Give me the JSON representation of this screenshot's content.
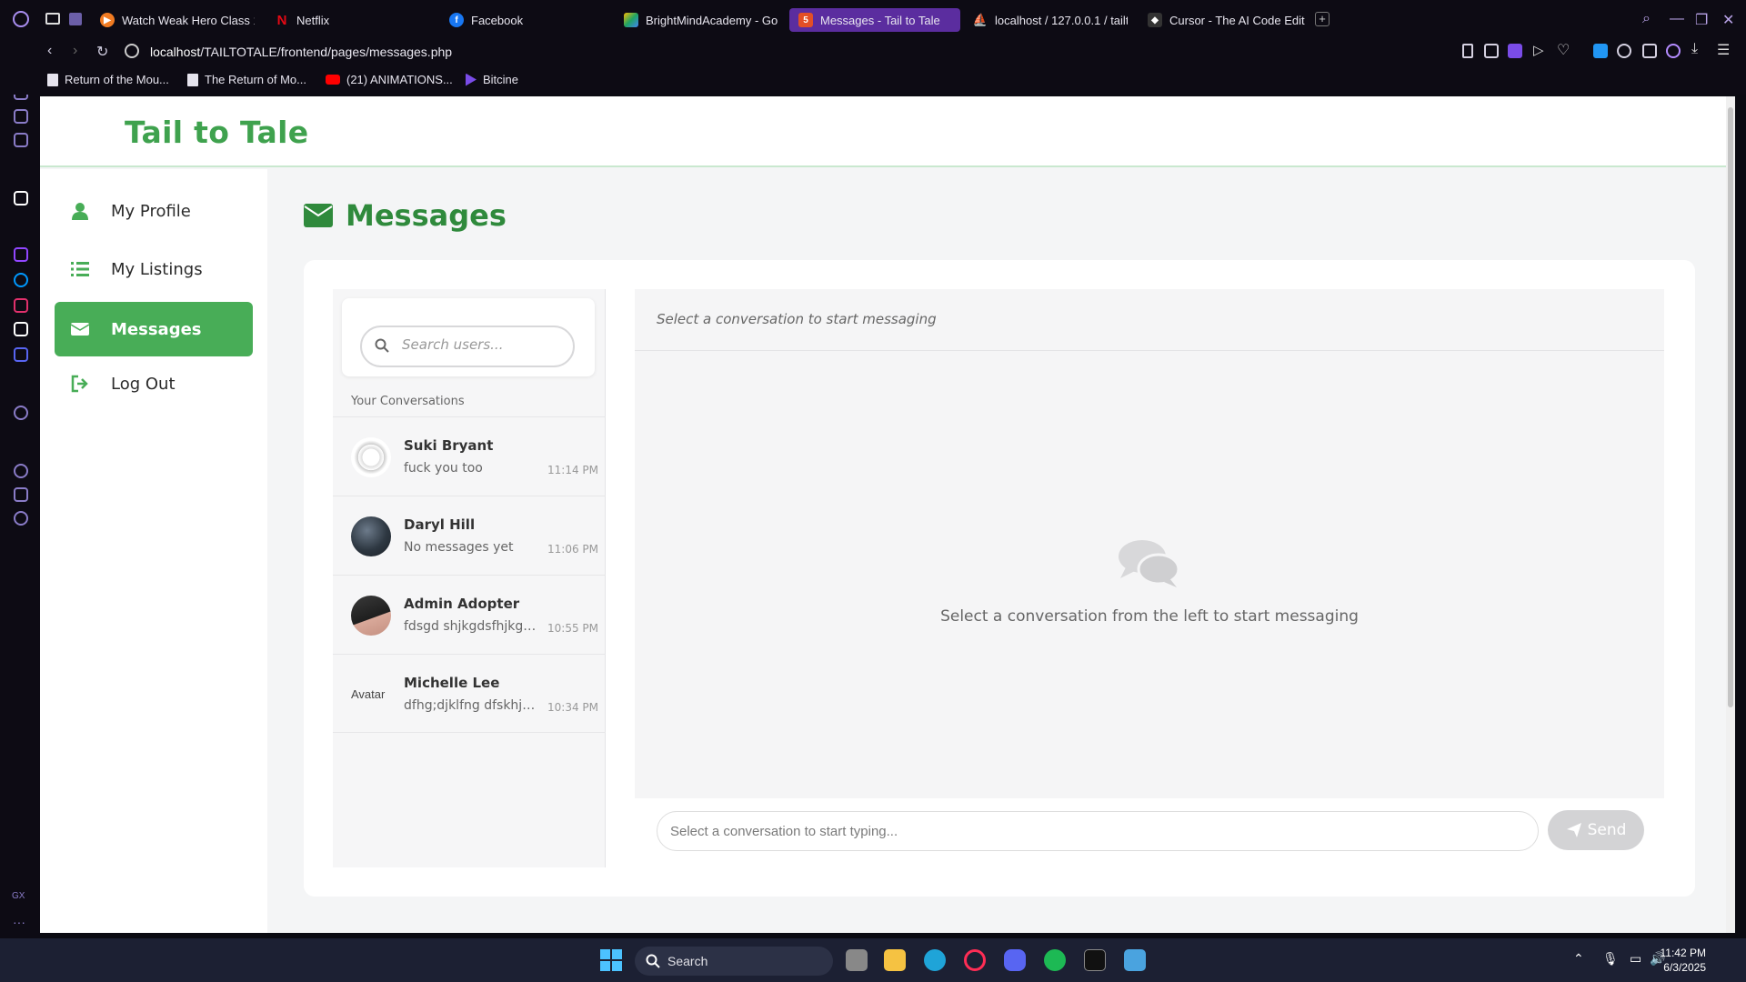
{
  "browser": {
    "tabs": [
      {
        "label": "Watch Weak Hero Class 1",
        "color": "#f07b22"
      },
      {
        "label": "Netflix",
        "color": "#e50914"
      },
      {
        "label": "Facebook",
        "color": "#1877f2"
      },
      {
        "label": "BrightMindAcademy - Go",
        "color": "#1fa463"
      },
      {
        "label": "Messages - Tail to Tale",
        "color": "#e34f26"
      },
      {
        "label": "localhost / 127.0.0.1 / tailt",
        "color": "#f29111"
      },
      {
        "label": "Cursor - The AI Code Edit",
        "color": "#333333"
      }
    ],
    "url_host": "localhost",
    "url_path": "/TAILTOTALE/frontend/pages/messages.php",
    "bookmarks": [
      "Return of the Mou...",
      "The Return of Mo...",
      "(21) ANIMATIONS...",
      "Bitcine"
    ]
  },
  "site": {
    "title": "Tail to Tale",
    "nav": [
      {
        "label": "My Profile",
        "icon": "user-icon"
      },
      {
        "label": "My Listings",
        "icon": "list-icon"
      },
      {
        "label": "Messages",
        "icon": "envelope-icon",
        "active": true
      },
      {
        "label": "Log Out",
        "icon": "logout-icon"
      }
    ],
    "heading": "Messages",
    "accent": "#48ad57"
  },
  "conversations": {
    "search_placeholder": "Search users...",
    "section_label": "Your Conversations",
    "items": [
      {
        "name": "Suki Bryant",
        "preview": "fuck you too",
        "time": "11:14 PM"
      },
      {
        "name": "Daryl Hill",
        "preview": "No messages yet",
        "time": "11:06 PM"
      },
      {
        "name": "Admin Adopter",
        "preview": "fdsgd shjkgdsfhjkg ...",
        "time": "10:55 PM"
      },
      {
        "name": "Michelle Lee",
        "preview": "dfhg;djklfng dfskhjv...",
        "time": "10:34 PM",
        "avatar_alt": "Avatar"
      }
    ]
  },
  "chat": {
    "header": "Select a conversation to start messaging",
    "empty_state": "Select a conversation from the left to start messaging",
    "input_placeholder": "Select a conversation to start typing...",
    "send_label": "Send"
  },
  "taskbar": {
    "search_label": "Search",
    "time": "11:42 PM",
    "date": "6/3/2025"
  }
}
